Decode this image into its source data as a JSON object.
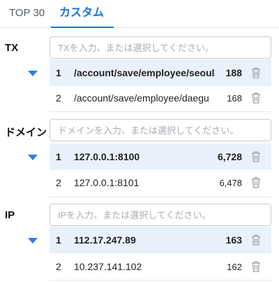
{
  "tabs": [
    {
      "label": "TOP 30"
    },
    {
      "label": "カスタム"
    }
  ],
  "sections": [
    {
      "label": "TX",
      "placeholder": "TXを入力、または選択してください。",
      "rows": [
        {
          "index": "1",
          "name": "/account/save/employee/seoul",
          "count": "188",
          "selected": true
        },
        {
          "index": "2",
          "name": "/account/save/employee/daegu",
          "count": "168",
          "selected": false
        }
      ]
    },
    {
      "label": "ドメイン",
      "placeholder": "ドメインを入力、または選択してください。",
      "rows": [
        {
          "index": "1",
          "name": "127.0.0.1:8100",
          "count": "6,728",
          "selected": true
        },
        {
          "index": "2",
          "name": "127.0.0.1:8101",
          "count": "6,478",
          "selected": false
        }
      ]
    },
    {
      "label": "IP",
      "placeholder": "IPを入力、または選択してください。",
      "rows": [
        {
          "index": "1",
          "name": "112.17.247.89",
          "count": "163",
          "selected": true
        },
        {
          "index": "2",
          "name": "10.237.141.102",
          "count": "162",
          "selected": false
        }
      ]
    }
  ],
  "colors": {
    "accent": "#1a73d9",
    "selected_row": "#e9f1fd",
    "caret": "#2a7de1"
  },
  "icons": {
    "delete": "trash-icon",
    "expand": "caret-down-icon"
  }
}
